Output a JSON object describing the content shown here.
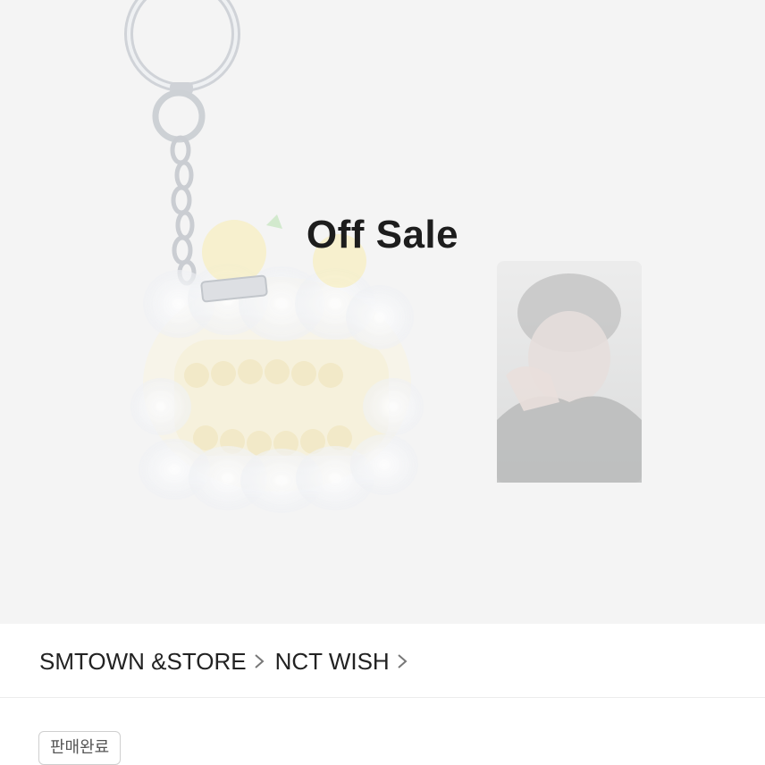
{
  "hero": {
    "overlay_text": "Off Sale",
    "product_image": "keyring-cake-icon",
    "photocard_image": "photocard-icon"
  },
  "breadcrumb": {
    "items": [
      {
        "label": "SMTOWN &STORE",
        "icon": "chevron-right-icon"
      },
      {
        "label": "NCT WISH",
        "icon": "chevron-right-icon"
      }
    ]
  },
  "status": {
    "badge_label": "판매완료"
  },
  "colors": {
    "hero_bg": "#f4f4f4",
    "badge_border": "#cfcfcf",
    "text": "#222222"
  }
}
